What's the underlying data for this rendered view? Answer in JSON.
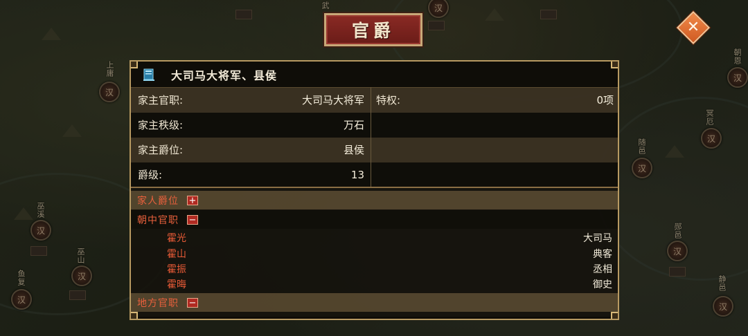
{
  "map": {
    "cities": [
      {
        "name": "上庸",
        "mark": "汉"
      },
      {
        "name": "巫溪",
        "mark": "汉"
      },
      {
        "name": "巫山",
        "mark": "汉"
      },
      {
        "name": "鱼复",
        "mark": "汉"
      },
      {
        "name": "朝恩",
        "mark": "汉"
      },
      {
        "name": "冥厄",
        "mark": "汉"
      },
      {
        "name": "随邑",
        "mark": "汉"
      },
      {
        "name": "郧邑",
        "mark": "汉"
      },
      {
        "name": "静邑",
        "mark": "汉"
      },
      {
        "name": "武",
        "mark": "汉"
      }
    ]
  },
  "title": "官爵",
  "close_icon": "close-icon",
  "header": {
    "icon": "book-icon",
    "title": "大司马大将军、县侯"
  },
  "info": {
    "rows": [
      {
        "label": "家主官职:",
        "value": "大司马大将军"
      },
      {
        "label": "家主秩级:",
        "value": "万石"
      },
      {
        "label": "家主爵位:",
        "value": "县侯"
      },
      {
        "label": "爵级:",
        "value": "13"
      }
    ],
    "privilege": {
      "label": "特权:",
      "value": "0项"
    }
  },
  "sections": {
    "family": {
      "label": "家人爵位",
      "toggle": "+"
    },
    "court": {
      "label": "朝中官职",
      "toggle": "−"
    },
    "local": {
      "label": "地方官职",
      "toggle": "−"
    }
  },
  "court_officials": [
    {
      "name": "霍光",
      "title": "大司马"
    },
    {
      "name": "霍山",
      "title": "典客"
    },
    {
      "name": "霍振",
      "title": "丞相"
    },
    {
      "name": "霍晦",
      "title": "御史"
    }
  ],
  "colors": {
    "accent_red": "#e85a36",
    "panel_border": "#b89a62",
    "plaque": "#8a2a24"
  }
}
